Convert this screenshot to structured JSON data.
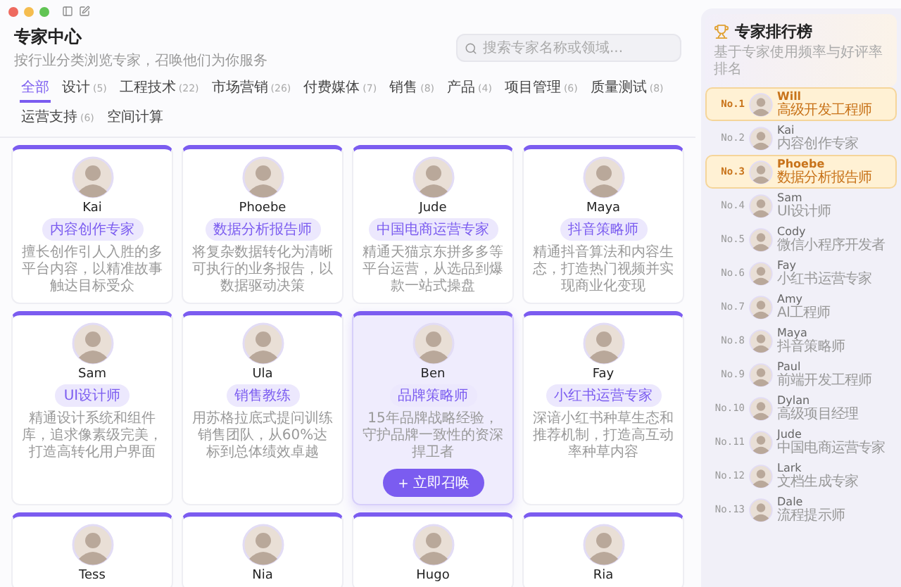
{
  "header": {
    "title": "专家中心",
    "subtitle": "按行业分类浏览专家，召唤他们为你服务"
  },
  "search": {
    "placeholder": "搜索专家名称或领域..."
  },
  "tabs": [
    {
      "label": "全部",
      "selected": true
    },
    {
      "label": "设计",
      "count": "(5)",
      "selected": false
    },
    {
      "label": "工程技术",
      "count": "(22)",
      "selected": false
    },
    {
      "label": "市场营销",
      "count": "(26)",
      "selected": false
    },
    {
      "label": "付费媒体",
      "count": "(7)",
      "selected": false
    },
    {
      "label": "销售",
      "count": "(8)",
      "selected": false
    },
    {
      "label": "产品",
      "count": "(4)",
      "selected": false
    },
    {
      "label": "项目管理",
      "count": "(6)",
      "selected": false
    },
    {
      "label": "质量测试",
      "count": "(8)",
      "selected": false
    },
    {
      "label": "运营支持",
      "count": "(6)",
      "selected": false
    },
    {
      "label": "空间计算",
      "selected": false
    }
  ],
  "experts": [
    {
      "name": "Kai",
      "role": "内容创作专家",
      "description": "擅长创作引人入胜的多平台内容，以精准故事触达目标受众",
      "hovered": false
    },
    {
      "name": "Phoebe",
      "role": "数据分析报告师",
      "description": "将复杂数据转化为清晰可执行的业务报告，以数据驱动决策",
      "hovered": false
    },
    {
      "name": "Jude",
      "role": "中国电商运营专家",
      "description": "精通天猫京东拼多多等平台运营，从选品到爆款一站式操盘",
      "hovered": false
    },
    {
      "name": "Maya",
      "role": "抖音策略师",
      "description": "精通抖音算法和内容生态，打造热门视频并实现商业化变现",
      "hovered": false
    },
    {
      "name": "Sam",
      "role": "UI设计师",
      "description": "精通设计系统和组件库，追求像素级完美，打造高转化用户界面",
      "hovered": false
    },
    {
      "name": "Ula",
      "role": "销售教练",
      "description": "用苏格拉底式提问训练销售团队，从60%达标到总体绩效卓越",
      "hovered": false
    },
    {
      "name": "Ben",
      "role": "品牌策略师",
      "description": "15年品牌战略经验，守护品牌一致性的资深捍卫者",
      "hovered": true,
      "button": "立即召唤"
    },
    {
      "name": "Fay",
      "role": "小红书运营专家",
      "description": "深谙小红书种草生态和推荐机制，打造高互动率种草内容",
      "hovered": false
    },
    {
      "name": "Tess",
      "hovered": false
    },
    {
      "name": "Nia",
      "hovered": false
    },
    {
      "name": "Hugo",
      "hovered": false
    },
    {
      "name": "Ria",
      "hovered": false
    }
  ],
  "leaderboard": {
    "title": "专家排行榜",
    "subtitle": "基于专家使用频率与好评率排名",
    "entries": [
      {
        "rank": "No.1",
        "name": "Will",
        "role": "高级开发工程师",
        "highlighted": true
      },
      {
        "rank": "No.2",
        "name": "Kai",
        "role": "内容创作专家",
        "highlighted": false
      },
      {
        "rank": "No.3",
        "name": "Phoebe",
        "role": "数据分析报告师",
        "highlighted": true
      },
      {
        "rank": "No.4",
        "name": "Sam",
        "role": "UI设计师",
        "highlighted": false
      },
      {
        "rank": "No.5",
        "name": "Cody",
        "role": "微信小程序开发者",
        "highlighted": false
      },
      {
        "rank": "No.6",
        "name": "Fay",
        "role": "小红书运营专家",
        "highlighted": false
      },
      {
        "rank": "No.7",
        "name": "Amy",
        "role": "AI工程师",
        "highlighted": false
      },
      {
        "rank": "No.8",
        "name": "Maya",
        "role": "抖音策略师",
        "highlighted": false
      },
      {
        "rank": "No.9",
        "name": "Paul",
        "role": "前端开发工程师",
        "highlighted": false
      },
      {
        "rank": "No.10",
        "name": "Dylan",
        "role": "高级项目经理",
        "highlighted": false
      },
      {
        "rank": "No.11",
        "name": "Jude",
        "role": "中国电商运营专家",
        "highlighted": false
      },
      {
        "rank": "No.12",
        "name": "Lark",
        "role": "文档生成专家",
        "highlighted": false
      },
      {
        "rank": "No.13",
        "name": "Dale",
        "role": "流程提示师",
        "highlighted": false
      }
    ]
  }
}
